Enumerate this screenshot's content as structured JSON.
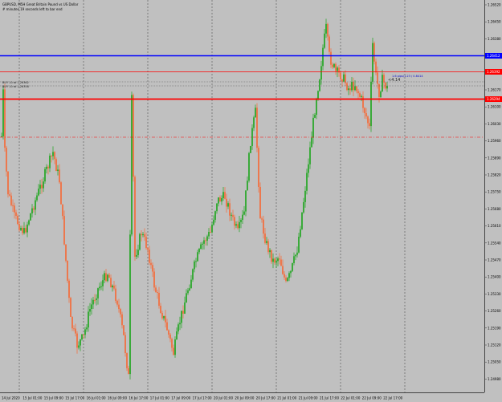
{
  "header": {
    "symbol_line": "GBPUSD, M5H  Great Britain Pound vs US Dollar",
    "status_line": "# minutes 19 seconds left to bar end"
  },
  "price_axis": [
    "1.26520",
    "1.26450",
    "1.26380",
    "1.26310",
    "1.26240",
    "1.26170",
    "1.26100",
    "1.26030",
    "1.25960",
    "1.25890",
    "1.25820",
    "1.25750",
    "1.25680",
    "1.25610",
    "1.25540",
    "1.25470",
    "1.25400",
    "1.25330",
    "1.25260",
    "1.25190",
    "1.25120",
    "1.25050",
    "1.24980"
  ],
  "time_axis": [
    "14 Jul 2020",
    "15 Jul 01:00",
    "15 Jul 09:00",
    "15 Jul 17:00",
    "16 Jul 01:00",
    "16 Jul 09:00",
    "16 Jul 17:00",
    "17 Jul 01:00",
    "17 Jul 09:00",
    "17 Jul 17:00",
    "20 Jul 01:00",
    "20 Jul 09:00",
    "20 Jul 17:00",
    "21 Jul 01:00",
    "21 Jul 09:00",
    "21 Jul 17:00",
    "22 Jul 01:00",
    "22 Jul 09:00",
    "22 Jul 17:00"
  ],
  "lines": {
    "blue_level_tag": "1.26412",
    "red_upper_tag": "1.26392",
    "red_lower_tag": "1.26294"
  },
  "trades": {
    "buy_1": "BUY 10 at 1.26362",
    "buy_2": "BUY 10 at 1.26358",
    "tp_info": "1.6 pips/1.23 / 0.8414",
    "price_note": "<4.14"
  },
  "candles": {
    "color_up": "#00a000",
    "color_down": "#ff5a1e",
    "blue_line": "#0000ff",
    "red_line": "#ff0000"
  }
}
